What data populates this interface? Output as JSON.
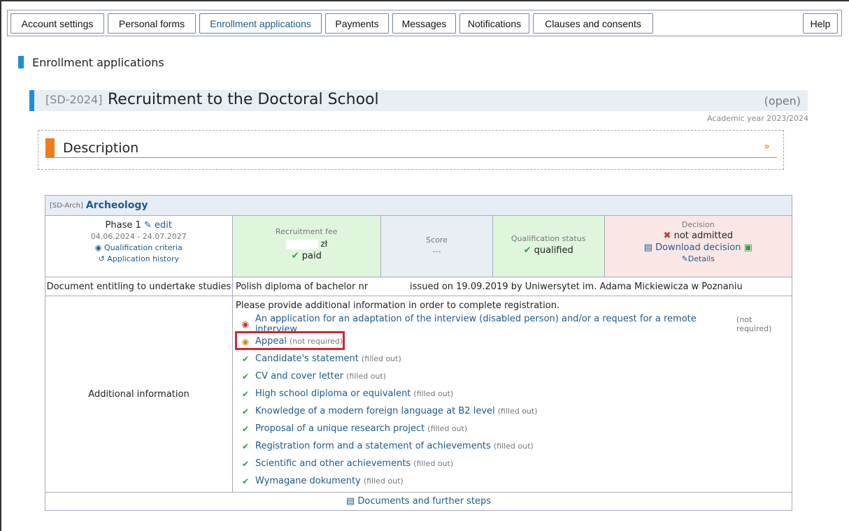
{
  "tabs": [
    {
      "label": "Account settings",
      "active": false
    },
    {
      "label": "Personal forms",
      "active": false
    },
    {
      "label": "Enrollment applications",
      "active": true
    },
    {
      "label": "Payments",
      "active": false
    },
    {
      "label": "Messages",
      "active": false
    },
    {
      "label": "Notifications",
      "active": false
    },
    {
      "label": "Clauses and consents",
      "active": false
    }
  ],
  "help_label": "Help",
  "section_title": "Enrollment applications",
  "recruitment": {
    "code": "[SD-2024]",
    "name": "Recruitment to the Doctoral School",
    "status": "(open)",
    "academic_year": "Academic year 2023/2024"
  },
  "description_label": "Description",
  "programme": {
    "code": "[SD-Arch]",
    "name": "Archeology"
  },
  "phase": {
    "label": "Phase 1",
    "edit_label": "edit",
    "dates": "04.06.2024 - 24.07.2027",
    "criteria_link": "Qualification criteria",
    "history_link": "Application history"
  },
  "fee": {
    "title": "Recruitment fee",
    "currency": "zł",
    "status": "paid"
  },
  "score": {
    "title": "Score",
    "value": "---"
  },
  "qualification": {
    "title": "Qualification status",
    "value": "qualified"
  },
  "decision": {
    "title": "Decision",
    "value": "not admitted",
    "download_label": "Download decision",
    "details_label": "Details"
  },
  "document_row": {
    "label": "Document entitling to undertake studies",
    "diploma": "Polish diploma of bachelor nr",
    "issued": "issued on 19.09.2019 by Uniwersytet im. Adama Mickiewicza w Poznaniu"
  },
  "additional": {
    "label": "Additional information",
    "intro": "Please provide additional information in order to complete registration.",
    "items": [
      {
        "title": "An application for an adaptation of the interview (disabled person) and/or a request for a remote interview",
        "note": "(not required)",
        "state": "notreq-red"
      },
      {
        "title": "Appeal",
        "note": "(not required)",
        "state": "notreq-orange"
      },
      {
        "title": "Candidate's statement",
        "note": "(filled out)",
        "state": "done"
      },
      {
        "title": "CV and cover letter",
        "note": "(filled out)",
        "state": "done"
      },
      {
        "title": "High school diploma or equivalent",
        "note": "(filled out)",
        "state": "done"
      },
      {
        "title": "Knowledge of a modern foreign language at B2 level",
        "note": "(filled out)",
        "state": "done"
      },
      {
        "title": "Proposal of a unique research project",
        "note": "(filled out)",
        "state": "done"
      },
      {
        "title": "Registration form and a statement of achievements",
        "note": "(filled out)",
        "state": "done"
      },
      {
        "title": "Scientific and other achievements",
        "note": "(filled out)",
        "state": "done"
      },
      {
        "title": "Wymagane dokumenty",
        "note": "(filled out)",
        "state": "done"
      }
    ]
  },
  "footer_link": "Documents and further steps",
  "colors": {
    "accent_blue": "#1c8fd9",
    "accent_orange": "#ee7b1e",
    "link": "#1f5a8c",
    "highlight_red": "#d9232e"
  }
}
